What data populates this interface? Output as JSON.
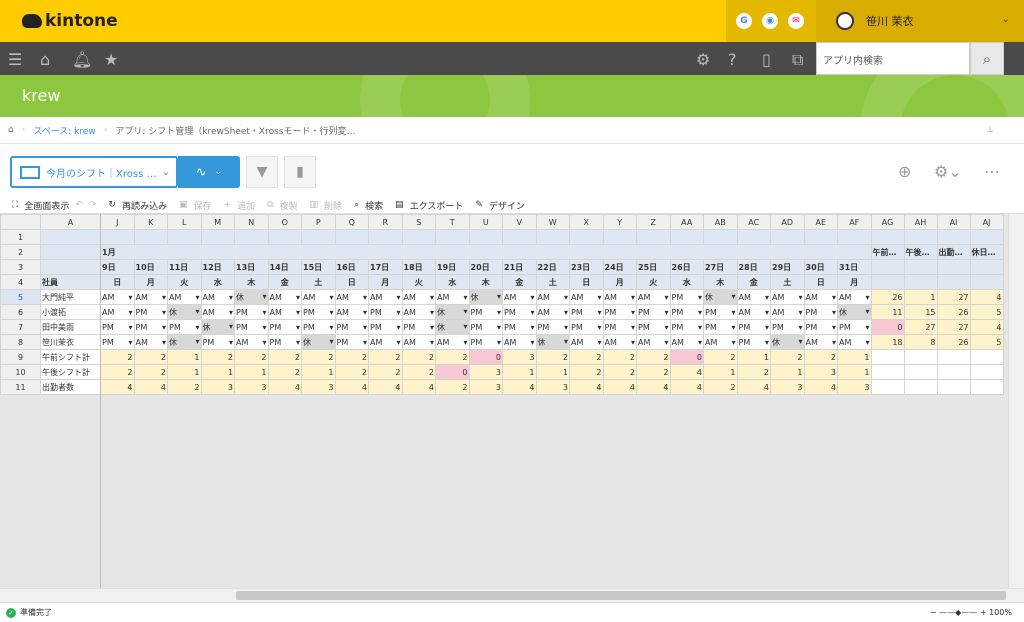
{
  "app": {
    "logo": "kintone"
  },
  "header": {
    "user_name": "笹川 茉衣",
    "search_placeholder": "アプリ内検索"
  },
  "space": {
    "title": "krew"
  },
  "breadcrumb": {
    "space": "スペース: krew",
    "app": "アプリ: シフト管理（krewSheet・Xrossモード・行列変…"
  },
  "view": {
    "label": "今月のシフト｜Xross …"
  },
  "toolbar": {
    "fullscreen": "全画面表示",
    "reload": "再読み込み",
    "save": "保存",
    "add": "追加",
    "delete_label": "複製",
    "remove": "削除",
    "search": "検索",
    "export": "エクスポート",
    "design": "デザイン"
  },
  "grid": {
    "col_headers": [
      "A",
      "J",
      "K",
      "L",
      "M",
      "N",
      "O",
      "P",
      "Q",
      "R",
      "S",
      "T",
      "U",
      "V",
      "W",
      "X",
      "Y",
      "Z",
      "AA",
      "AB",
      "AC",
      "AD",
      "AE",
      "AF",
      "AG",
      "AH",
      "AI",
      "AJ"
    ],
    "row_numbers": [
      "1",
      "2",
      "3",
      "4",
      "5",
      "6",
      "7",
      "8",
      "9",
      "10",
      "11"
    ],
    "month": "1月",
    "dates": [
      "9日",
      "10日",
      "11日",
      "12日",
      "13日",
      "14日",
      "15日",
      "16日",
      "17日",
      "18日",
      "19日",
      "20日",
      "21日",
      "22日",
      "23日",
      "24日",
      "25日",
      "26日",
      "27日",
      "28日",
      "29日",
      "30日",
      "31日"
    ],
    "weekdays": [
      "日",
      "月",
      "火",
      "水",
      "木",
      "金",
      "土",
      "日",
      "月",
      "火",
      "水",
      "木",
      "金",
      "土",
      "日",
      "月",
      "火",
      "水",
      "木",
      "金",
      "土",
      "日",
      "月"
    ],
    "summary_headers": [
      "午前…",
      "午後…",
      "出勤…",
      "休日…"
    ],
    "staff_header": "社員",
    "staff": [
      {
        "name": "大門純平",
        "shifts": [
          "AM",
          "AM",
          "AM",
          "AM",
          "休",
          "AM",
          "AM",
          "AM",
          "AM",
          "AM",
          "AM",
          "休",
          "AM",
          "AM",
          "AM",
          "AM",
          "AM",
          "PM",
          "休",
          "AM",
          "AM",
          "AM",
          "AM"
        ],
        "summary": [
          "26",
          "1",
          "27",
          "4"
        ]
      },
      {
        "name": "小渡拓",
        "shifts": [
          "AM",
          "PM",
          "休",
          "AM",
          "PM",
          "AM",
          "PM",
          "AM",
          "PM",
          "AM",
          "休",
          "PM",
          "PM",
          "AM",
          "PM",
          "PM",
          "PM",
          "PM",
          "PM",
          "AM",
          "AM",
          "PM",
          "休"
        ],
        "summary": [
          "11",
          "15",
          "26",
          "5"
        ]
      },
      {
        "name": "田中美雨",
        "shifts": [
          "PM",
          "PM",
          "PM",
          "休",
          "PM",
          "PM",
          "PM",
          "PM",
          "PM",
          "PM",
          "休",
          "PM",
          "PM",
          "PM",
          "PM",
          "PM",
          "PM",
          "PM",
          "PM",
          "PM",
          "PM",
          "PM",
          "PM"
        ],
        "summary": [
          "0",
          "27",
          "27",
          "4"
        ]
      },
      {
        "name": "笹川茉衣",
        "shifts": [
          "PM",
          "AM",
          "休",
          "PM",
          "AM",
          "PM",
          "休",
          "PM",
          "AM",
          "AM",
          "AM",
          "PM",
          "AM",
          "休",
          "AM",
          "AM",
          "AM",
          "AM",
          "AM",
          "PM",
          "休",
          "AM",
          "AM"
        ],
        "summary": [
          "18",
          "8",
          "26",
          "5"
        ]
      }
    ],
    "totals": [
      {
        "label": "午前シフト計",
        "values": [
          "2",
          "2",
          "1",
          "2",
          "2",
          "2",
          "2",
          "2",
          "2",
          "2",
          "2",
          "0",
          "3",
          "2",
          "2",
          "2",
          "2",
          "0",
          "2",
          "1",
          "2",
          "2",
          "1"
        ]
      },
      {
        "label": "午後シフト計",
        "values": [
          "2",
          "2",
          "1",
          "1",
          "1",
          "2",
          "1",
          "2",
          "2",
          "2",
          "0",
          "3",
          "1",
          "1",
          "2",
          "2",
          "2",
          "4",
          "1",
          "2",
          "1",
          "3",
          "1"
        ]
      },
      {
        "label": "出勤者数",
        "values": [
          "4",
          "4",
          "2",
          "3",
          "3",
          "4",
          "3",
          "4",
          "4",
          "4",
          "2",
          "3",
          "4",
          "3",
          "4",
          "4",
          "4",
          "4",
          "2",
          "4",
          "3",
          "4",
          "3"
        ]
      }
    ]
  },
  "status": {
    "ready": "準備完了",
    "zoom": "100%"
  }
}
